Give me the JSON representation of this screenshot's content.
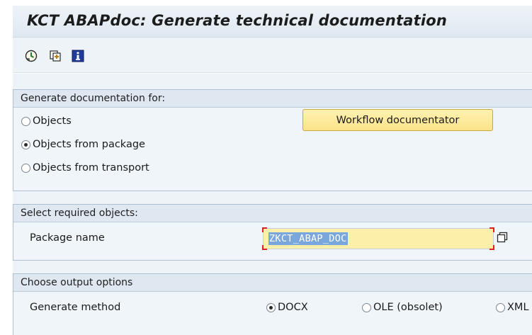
{
  "window": {
    "title": "KCT ABAPdoc: Generate technical documentation"
  },
  "toolbar": {
    "buttons": [
      {
        "icon": "execute-icon",
        "tooltip": ""
      },
      {
        "icon": "variant-icon",
        "tooltip": ""
      },
      {
        "icon": "info-icon",
        "tooltip": ""
      }
    ]
  },
  "group_documentation": {
    "header": "Generate documentation for:",
    "options": [
      {
        "label": "Objects",
        "checked": false
      },
      {
        "label": "Objects from package",
        "checked": true
      },
      {
        "label": "Objects from transport",
        "checked": false
      }
    ],
    "workflow_button": "Workflow documentator"
  },
  "group_objects": {
    "header": "Select required objects:",
    "package_label": "Package name",
    "package_value": "ZKCT_ABAP_DOC"
  },
  "group_output": {
    "header": "Choose output options",
    "method_label": "Generate method",
    "methods": [
      {
        "label": "DOCX",
        "checked": true
      },
      {
        "label": "OLE (obsolet)",
        "checked": false
      },
      {
        "label": "XML",
        "checked": false
      }
    ]
  },
  "colors": {
    "accent_button": "#fbe38a",
    "input_highlight": "#fcefa9",
    "required_marker": "#e02020"
  }
}
